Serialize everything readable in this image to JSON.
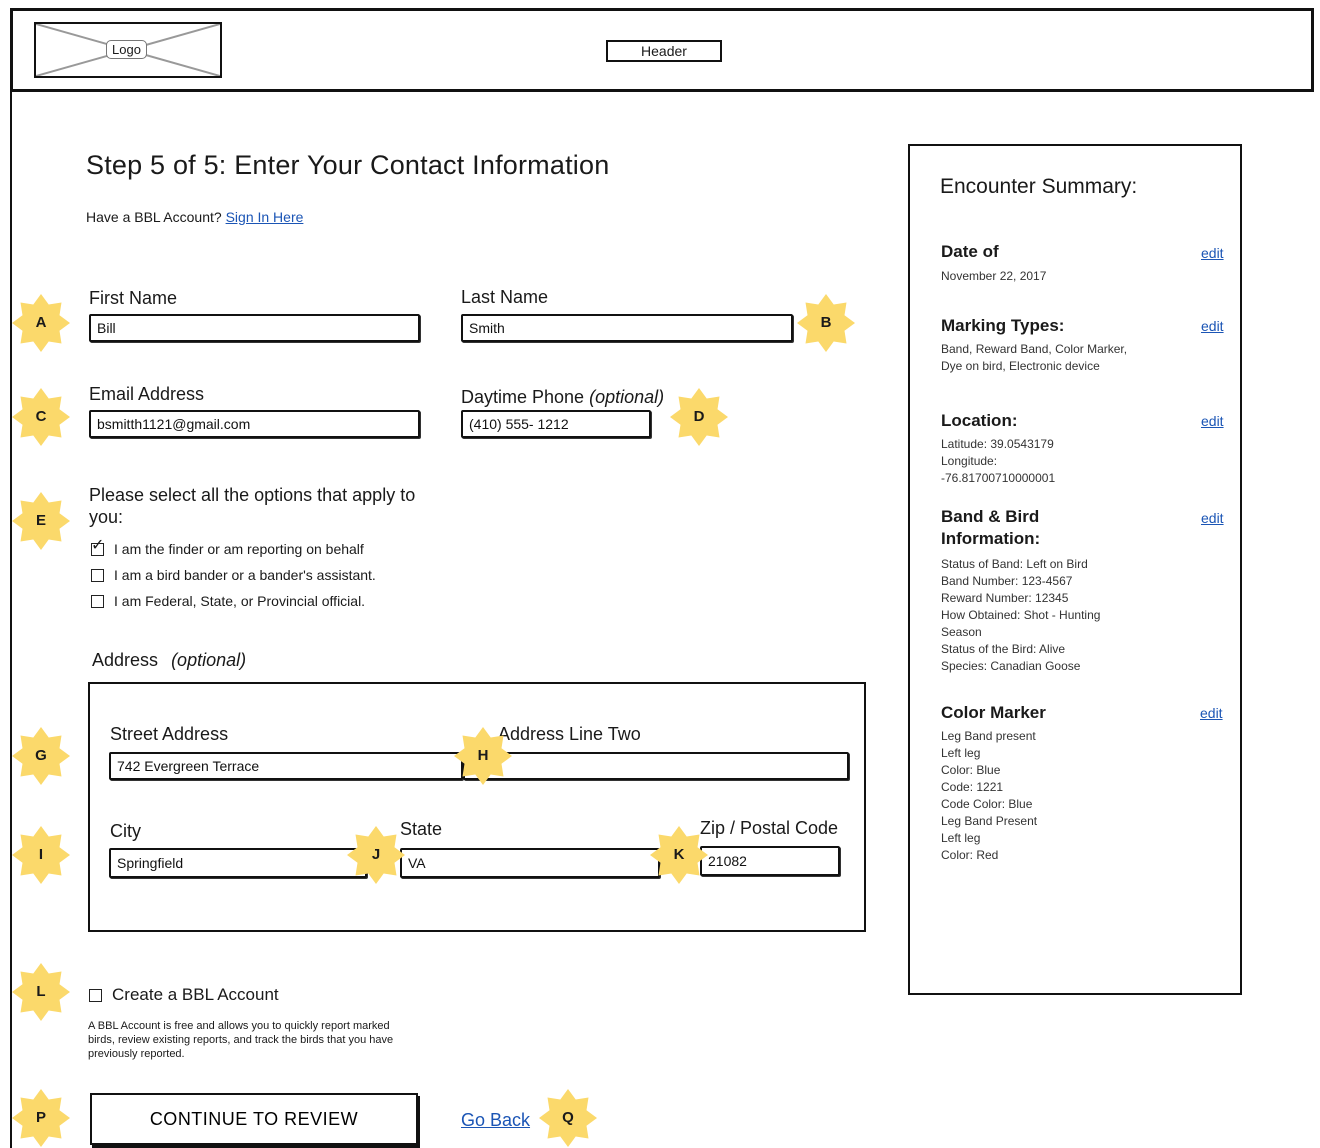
{
  "header": {
    "logo_label": "Logo",
    "header_label": "Header"
  },
  "page": {
    "title": "Step 5 of 5: Enter Your Contact Information",
    "account_prompt": "Have a BBL Account?",
    "signin_link": "Sign In Here"
  },
  "contact": {
    "first_name_label": "First Name",
    "first_name_value": "Bill",
    "last_name_label": "Last Name",
    "last_name_value": "Smith",
    "email_label": "Email Address",
    "email_value": "bsmitth1121@gmail.com",
    "phone_label": "Daytime Phone",
    "phone_optional": "(optional)",
    "phone_value": "(410) 555- 1212"
  },
  "options": {
    "prompt": "Please select all the options that apply to you:",
    "items": [
      {
        "label": "I am the finder or am reporting on behalf",
        "checked": true
      },
      {
        "label": "I am a bird bander or a bander's assistant.",
        "checked": false
      },
      {
        "label": "I am Federal, State, or Provincial official.",
        "checked": false
      }
    ]
  },
  "address": {
    "heading": "Address",
    "optional": "(optional)",
    "street_label": "Street Address",
    "street_value": "742 Evergreen Terrace",
    "line2_label": "Address Line Two",
    "line2_value": "",
    "city_label": "City",
    "city_value": "Springfield",
    "state_label": "State",
    "state_value": "VA",
    "zip_label": "Zip / Postal Code",
    "zip_value": "21082"
  },
  "account": {
    "create_label": "Create a BBL Account",
    "create_checked": false,
    "description": "A BBL Account is free and allows you to quickly report marked birds, review existing reports, and track the birds that you have previously reported."
  },
  "actions": {
    "continue_label": "CONTINUE TO REVIEW",
    "back_label": "Go Back"
  },
  "annotations": {
    "a": "A",
    "b": "B",
    "c": "C",
    "d": "D",
    "e": "E",
    "g": "G",
    "h": "H",
    "i": "I",
    "j": "J",
    "k": "K",
    "l": "L",
    "p": "P",
    "q": "Q"
  },
  "summary": {
    "title": "Encounter Summary:",
    "edit_label": "edit",
    "date_title": "Date of",
    "date_value": "November 22, 2017",
    "marking_title": "Marking Types:",
    "marking_value": "Band, Reward Band, Color Marker, Dye on bird, Electronic device",
    "location_title": "Location:",
    "location_lines": [
      "Latitude: 39.0543179",
      "Longitude:",
      "-76.81700710000001"
    ],
    "band_title_1": "Band & Bird",
    "band_title_2": "Information:",
    "band_lines": [
      "Status of Band: Left on Bird",
      "Band Number: 123-4567",
      "Reward Number: 12345",
      "How Obtained: Shot - Hunting",
      "Season",
      "Status of the Bird: Alive",
      "Species: Canadian Goose"
    ],
    "color_title": "Color Marker",
    "color_lines": [
      "Leg Band present",
      "Left leg",
      "Color: Blue",
      "Code: 1221",
      "Code Color: Blue",
      "Leg Band Present",
      "Left leg",
      "Color: Red"
    ]
  },
  "colors": {
    "star": "#fbd96b",
    "link": "#1b55b5"
  }
}
